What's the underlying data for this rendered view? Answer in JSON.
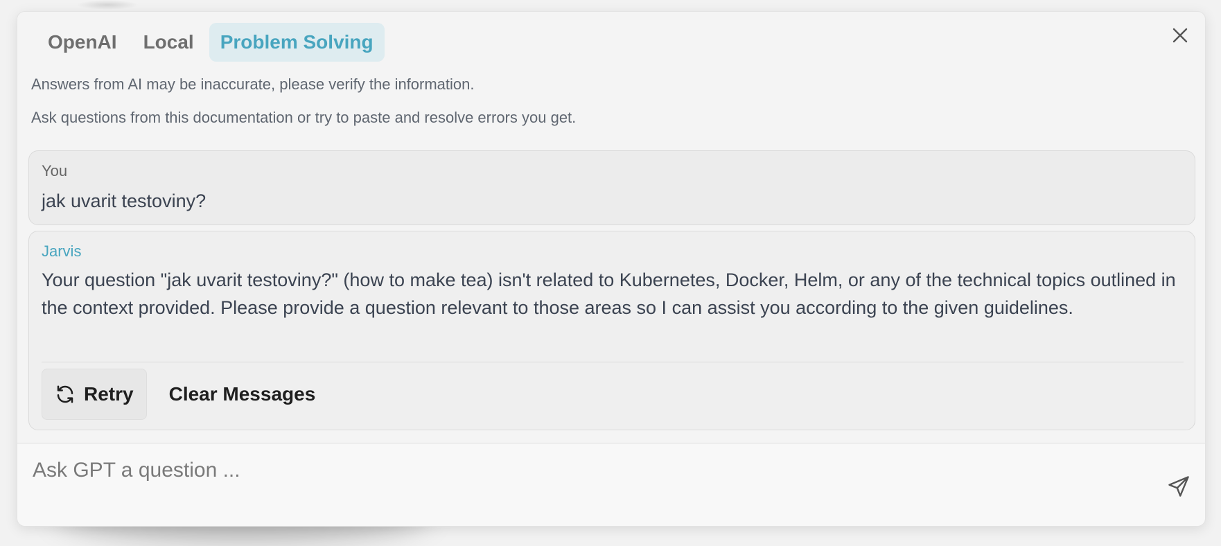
{
  "tabs": [
    {
      "label": "OpenAI",
      "active": false
    },
    {
      "label": "Local",
      "active": false
    },
    {
      "label": "Problem Solving",
      "active": true
    }
  ],
  "notices": {
    "disclaimer": "Answers from AI may be inaccurate, please verify the information.",
    "hint": "Ask questions from this documentation or try to paste and resolve errors you get."
  },
  "messages": {
    "user": {
      "author": "You",
      "text": "jak uvarit testoviny?"
    },
    "assistant": {
      "author": "Jarvis",
      "text": "Your question \"jak uvarit testoviny?\" (how to make tea) isn't related to Kubernetes, Docker, Helm, or any of the technical topics outlined in the context provided. Please provide a question relevant to those areas so I can assist you according to the given guidelines."
    }
  },
  "actions": {
    "retry_label": "Retry",
    "clear_label": "Clear Messages"
  },
  "composer": {
    "placeholder": "Ask GPT a question ..."
  },
  "icons": {
    "close": "close-icon",
    "retry": "refresh-icon",
    "send": "send-icon"
  },
  "colors": {
    "accent": "#48a5bf",
    "active_tab_bg": "#deecf0"
  }
}
